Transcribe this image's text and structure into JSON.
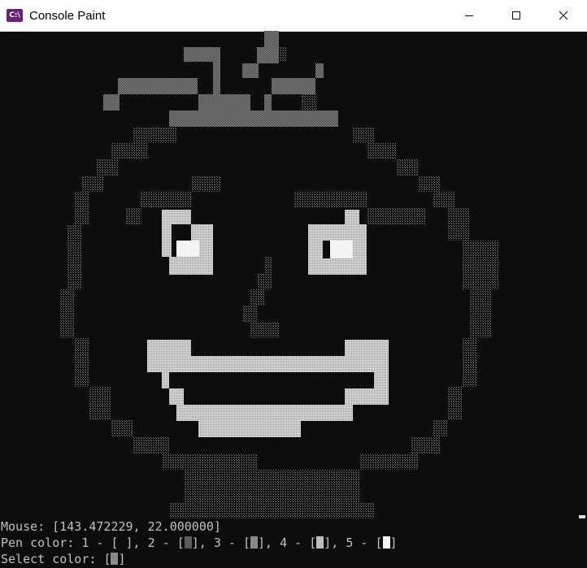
{
  "window": {
    "title": "Console Paint",
    "icon": "console-app-icon",
    "icon_text": "C:\\",
    "controls": [
      "minimize-icon",
      "maximize-icon",
      "close-icon"
    ]
  },
  "status": {
    "mouse_label": "Mouse: ",
    "mouse_value": "[143.472229, 22.000000]",
    "pen_label": "Pen color: ",
    "pen_options": [
      {
        "key": "1",
        "glyph": " ",
        "color": "#0c0c0c"
      },
      {
        "key": "2",
        "glyph": "░",
        "color": "#5a5a5a"
      },
      {
        "key": "3",
        "glyph": "▒",
        "color": "#8a8a8a"
      },
      {
        "key": "4",
        "glyph": "▓",
        "color": "#bdbdbd"
      },
      {
        "key": "5",
        "glyph": "█",
        "color": "#f2f2f2"
      }
    ],
    "select_label": "Select color: ",
    "selected_glyph": "▒"
  },
  "colors": {
    "background": "#0c0c0c",
    "text": "#c0c0c0",
    "shade_light": "#6a6a6a",
    "shade_medium": "#9a9a9a",
    "shade_heavy": "#cfcfcf",
    "shade_full": "#f2f2f2"
  }
}
